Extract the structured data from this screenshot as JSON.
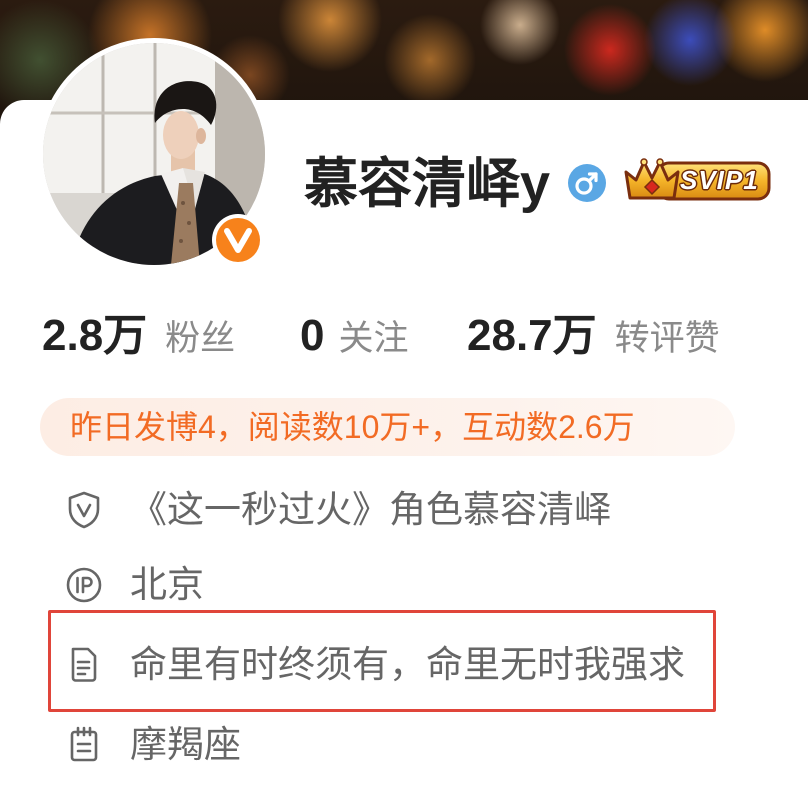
{
  "profile": {
    "name": "慕容清峄y",
    "avatar_icon": "avatar-photo",
    "verified_icon": "verified-v-icon",
    "gender_icon": "male-icon",
    "vip_badge": {
      "icon": "crown-icon",
      "label": "SVIP1"
    }
  },
  "stats": [
    {
      "value": "2.8万",
      "label": "粉丝"
    },
    {
      "value": "0",
      "label": "关注"
    },
    {
      "value": "28.7万",
      "label": "转评赞"
    }
  ],
  "activity_banner": {
    "text": "昨日发博4，阅读数10万+，互动数2.6万"
  },
  "info": [
    {
      "icon": "shield-v-icon",
      "text": "《这一秒过火》角色慕容清峄",
      "highlighted": false
    },
    {
      "icon": "ip-location-icon",
      "text": "北京",
      "highlighted": false
    },
    {
      "icon": "document-icon",
      "text": "命里有时终须有，命里无时我强求",
      "highlighted": true
    },
    {
      "icon": "notepad-icon",
      "text": "摩羯座",
      "highlighted": false
    }
  ],
  "colors": {
    "accent_orange": "#f26b24",
    "banner_background": "#fdf0e9",
    "highlight_border": "#e0453a",
    "male_icon_blue": "#5aa7e4",
    "verified_orange": "#f7821b",
    "name_text": "#222222",
    "secondary_text": "#666666"
  }
}
